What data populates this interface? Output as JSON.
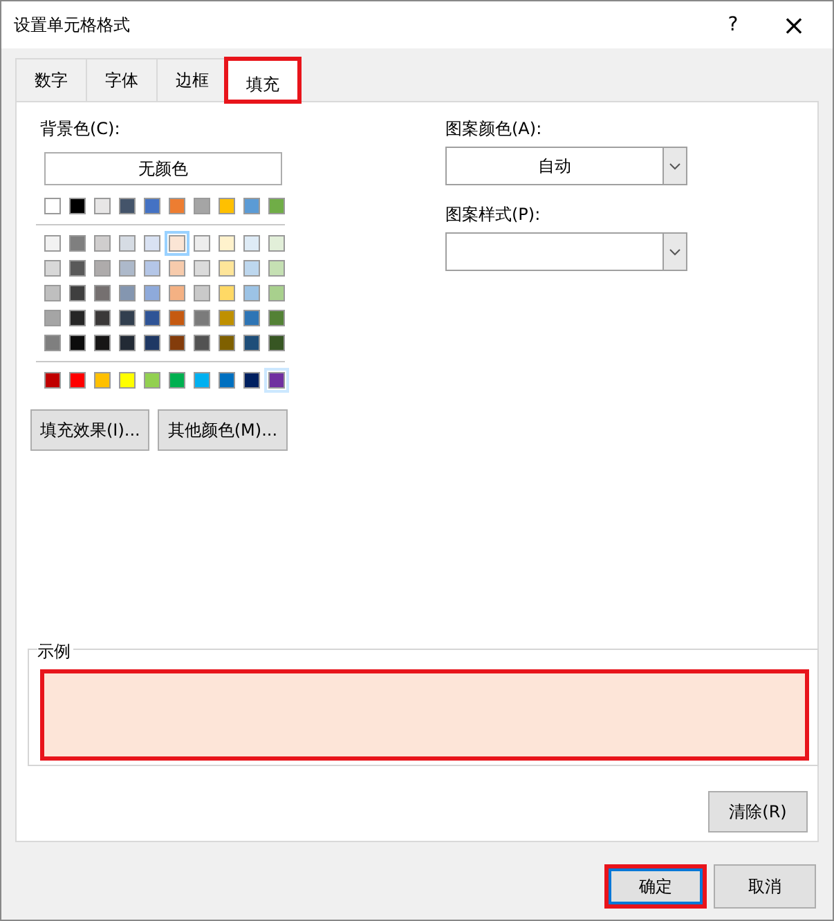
{
  "window": {
    "title": "设置单元格格式",
    "help": "?",
    "close": "×"
  },
  "tabs": [
    {
      "label": "数字",
      "selected": false,
      "annotated": false
    },
    {
      "label": "字体",
      "selected": false,
      "annotated": false
    },
    {
      "label": "边框",
      "selected": false,
      "annotated": false
    },
    {
      "label": "填充",
      "selected": true,
      "annotated": true
    }
  ],
  "background": {
    "label": "背景色(C):",
    "no_color": "无颜色",
    "theme_row": [
      {
        "color": "#ffffff",
        "selected": false,
        "hovered": false
      },
      {
        "color": "#000000",
        "selected": false,
        "hovered": false
      },
      {
        "color": "#e7e6e6",
        "selected": false,
        "hovered": false
      },
      {
        "color": "#44546a",
        "selected": false,
        "hovered": false
      },
      {
        "color": "#4472c4",
        "selected": false,
        "hovered": false
      },
      {
        "color": "#ed7d31",
        "selected": false,
        "hovered": false
      },
      {
        "color": "#a5a5a5",
        "selected": false,
        "hovered": false
      },
      {
        "color": "#ffc000",
        "selected": false,
        "hovered": false
      },
      {
        "color": "#5b9bd5",
        "selected": false,
        "hovered": false
      },
      {
        "color": "#70ad47",
        "selected": false,
        "hovered": false
      }
    ],
    "tint_rows": [
      [
        {
          "color": "#f2f2f2",
          "selected": false,
          "hovered": false
        },
        {
          "color": "#7f7f7f",
          "selected": false,
          "hovered": false
        },
        {
          "color": "#d0cece",
          "selected": false,
          "hovered": false
        },
        {
          "color": "#d6dce4",
          "selected": false,
          "hovered": false
        },
        {
          "color": "#d9e2f3",
          "selected": false,
          "hovered": false
        },
        {
          "color": "#fbe5d5",
          "selected": true,
          "hovered": false
        },
        {
          "color": "#ededed",
          "selected": false,
          "hovered": false
        },
        {
          "color": "#fff2cc",
          "selected": false,
          "hovered": false
        },
        {
          "color": "#deebf6",
          "selected": false,
          "hovered": false
        },
        {
          "color": "#e2efd9",
          "selected": false,
          "hovered": false
        }
      ],
      [
        {
          "color": "#d8d8d8",
          "selected": false,
          "hovered": false
        },
        {
          "color": "#595959",
          "selected": false,
          "hovered": false
        },
        {
          "color": "#aeabab",
          "selected": false,
          "hovered": false
        },
        {
          "color": "#adb9ca",
          "selected": false,
          "hovered": false
        },
        {
          "color": "#b4c6e7",
          "selected": false,
          "hovered": false
        },
        {
          "color": "#f7cbac",
          "selected": false,
          "hovered": false
        },
        {
          "color": "#dbdbdb",
          "selected": false,
          "hovered": false
        },
        {
          "color": "#fee599",
          "selected": false,
          "hovered": false
        },
        {
          "color": "#bdd7ee",
          "selected": false,
          "hovered": false
        },
        {
          "color": "#c5e0b3",
          "selected": false,
          "hovered": false
        }
      ],
      [
        {
          "color": "#bfbfbf",
          "selected": false,
          "hovered": false
        },
        {
          "color": "#3f3f3f",
          "selected": false,
          "hovered": false
        },
        {
          "color": "#757070",
          "selected": false,
          "hovered": false
        },
        {
          "color": "#8496b0",
          "selected": false,
          "hovered": false
        },
        {
          "color": "#8eaadb",
          "selected": false,
          "hovered": false
        },
        {
          "color": "#f4b183",
          "selected": false,
          "hovered": false
        },
        {
          "color": "#c9c9c9",
          "selected": false,
          "hovered": false
        },
        {
          "color": "#ffd965",
          "selected": false,
          "hovered": false
        },
        {
          "color": "#9cc3e5",
          "selected": false,
          "hovered": false
        },
        {
          "color": "#a8d08d",
          "selected": false,
          "hovered": false
        }
      ],
      [
        {
          "color": "#a5a5a5",
          "selected": false,
          "hovered": false
        },
        {
          "color": "#262626",
          "selected": false,
          "hovered": false
        },
        {
          "color": "#3a3838",
          "selected": false,
          "hovered": false
        },
        {
          "color": "#323f4f",
          "selected": false,
          "hovered": false
        },
        {
          "color": "#2f5496",
          "selected": false,
          "hovered": false
        },
        {
          "color": "#c55a11",
          "selected": false,
          "hovered": false
        },
        {
          "color": "#7b7b7b",
          "selected": false,
          "hovered": false
        },
        {
          "color": "#bf9000",
          "selected": false,
          "hovered": false
        },
        {
          "color": "#2e75b5",
          "selected": false,
          "hovered": false
        },
        {
          "color": "#538135",
          "selected": false,
          "hovered": false
        }
      ],
      [
        {
          "color": "#7f7f7f",
          "selected": false,
          "hovered": false
        },
        {
          "color": "#0c0c0c",
          "selected": false,
          "hovered": false
        },
        {
          "color": "#171616",
          "selected": false,
          "hovered": false
        },
        {
          "color": "#222a35",
          "selected": false,
          "hovered": false
        },
        {
          "color": "#1f3864",
          "selected": false,
          "hovered": false
        },
        {
          "color": "#833c0b",
          "selected": false,
          "hovered": false
        },
        {
          "color": "#525252",
          "selected": false,
          "hovered": false
        },
        {
          "color": "#7f6000",
          "selected": false,
          "hovered": false
        },
        {
          "color": "#1e4e79",
          "selected": false,
          "hovered": false
        },
        {
          "color": "#375623",
          "selected": false,
          "hovered": false
        }
      ]
    ],
    "standard_row": [
      {
        "color": "#c00000",
        "selected": false,
        "hovered": false
      },
      {
        "color": "#ff0000",
        "selected": false,
        "hovered": false
      },
      {
        "color": "#ffc000",
        "selected": false,
        "hovered": false
      },
      {
        "color": "#ffff00",
        "selected": false,
        "hovered": false
      },
      {
        "color": "#92d050",
        "selected": false,
        "hovered": false
      },
      {
        "color": "#00b050",
        "selected": false,
        "hovered": false
      },
      {
        "color": "#00b0f0",
        "selected": false,
        "hovered": false
      },
      {
        "color": "#0070c0",
        "selected": false,
        "hovered": false
      },
      {
        "color": "#002060",
        "selected": false,
        "hovered": false
      },
      {
        "color": "#7030a0",
        "selected": false,
        "hovered": true
      }
    ],
    "buttons": [
      "填充效果(I)...",
      "其他颜色(M)..."
    ]
  },
  "pattern_color": {
    "label": "图案颜色(A):",
    "value": "自动"
  },
  "pattern_style": {
    "label": "图案样式(P):"
  },
  "sample": {
    "label": "示例",
    "color": "#fde5d8",
    "annotated": true
  },
  "clear_button": "清除(R)",
  "footer_buttons": [
    {
      "label": "确定",
      "default": true,
      "annotated": true
    },
    {
      "label": "取消",
      "default": false,
      "annotated": false
    }
  ]
}
